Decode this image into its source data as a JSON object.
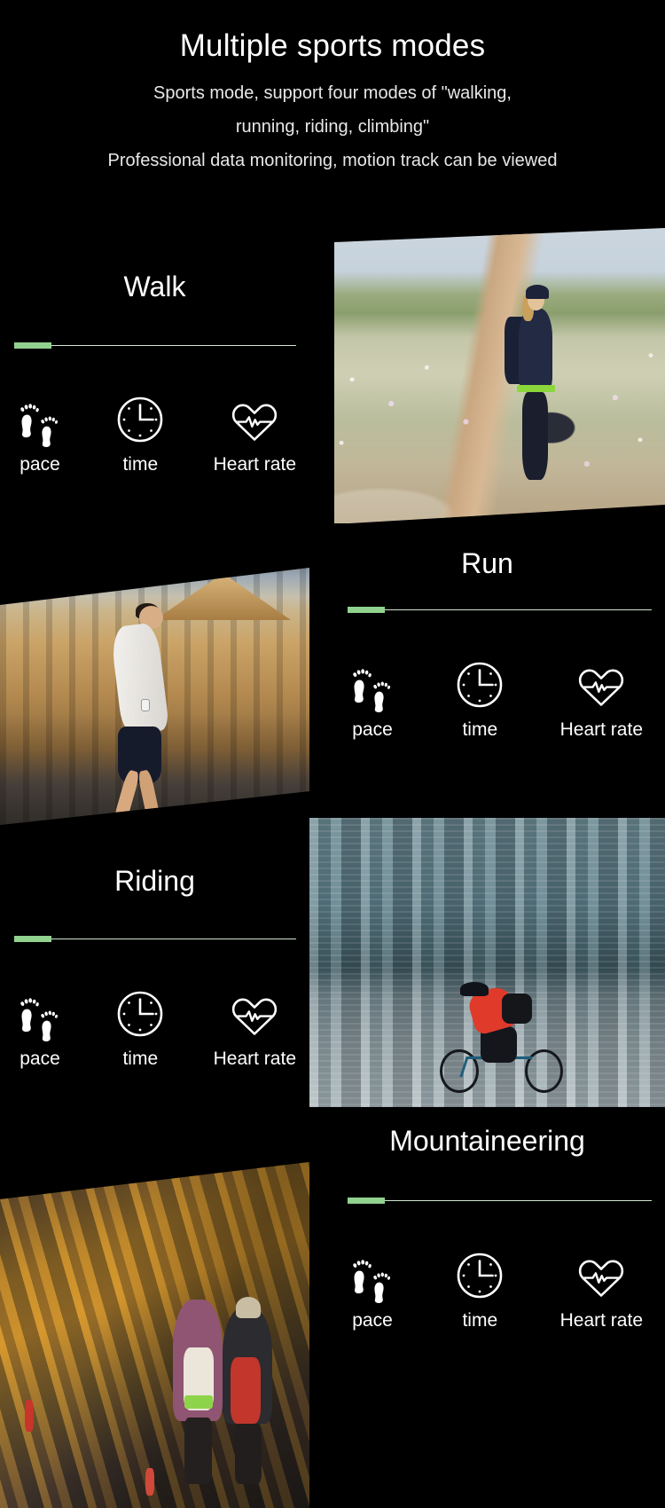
{
  "header": {
    "title": "Multiple sports modes",
    "subtitle_line1": "Sports mode, support four modes of \"walking,",
    "subtitle_line2": "running, riding, climbing\"",
    "subtitle_line3": "Professional data monitoring, motion track can be viewed"
  },
  "colors": {
    "background": "#000000",
    "text": "#ffffff",
    "accent_green": "#91d28f",
    "divider_line": "#cfe6cf"
  },
  "metric_icons": {
    "pace": "footprints-icon",
    "time": "clock-icon",
    "heart_rate": "heart-pulse-icon"
  },
  "sections": [
    {
      "id": "walk",
      "title": "Walk",
      "title_side": "left",
      "photo_name": "walking-photo",
      "photo_alt": "Woman with backpack walking on a flower-lined trail",
      "metrics": [
        {
          "icon": "footprints-icon",
          "label": "pace"
        },
        {
          "icon": "clock-icon",
          "label": "time"
        },
        {
          "icon": "heart-pulse-icon",
          "label": "Heart rate"
        }
      ]
    },
    {
      "id": "run",
      "title": "Run",
      "title_side": "right",
      "photo_name": "running-photo",
      "photo_alt": "Man running past a classical building at sunset",
      "metrics": [
        {
          "icon": "footprints-icon",
          "label": "pace"
        },
        {
          "icon": "clock-icon",
          "label": "time"
        },
        {
          "icon": "heart-pulse-icon",
          "label": "Heart rate"
        }
      ]
    },
    {
      "id": "riding",
      "title": "Riding",
      "title_side": "left",
      "photo_name": "riding-photo",
      "photo_alt": "Cyclist riding through a motion-blurred city street",
      "metrics": [
        {
          "icon": "footprints-icon",
          "label": "pace"
        },
        {
          "icon": "clock-icon",
          "label": "time"
        },
        {
          "icon": "heart-pulse-icon",
          "label": "Heart rate"
        }
      ]
    },
    {
      "id": "mountaineering",
      "title": "Mountaineering",
      "title_side": "right",
      "photo_name": "mountaineering-photo",
      "photo_alt": "Two hikers with backpacks on a golden mountain ridge",
      "metrics": [
        {
          "icon": "footprints-icon",
          "label": "pace"
        },
        {
          "icon": "clock-icon",
          "label": "time"
        },
        {
          "icon": "heart-pulse-icon",
          "label": "Heart rate"
        }
      ]
    }
  ]
}
